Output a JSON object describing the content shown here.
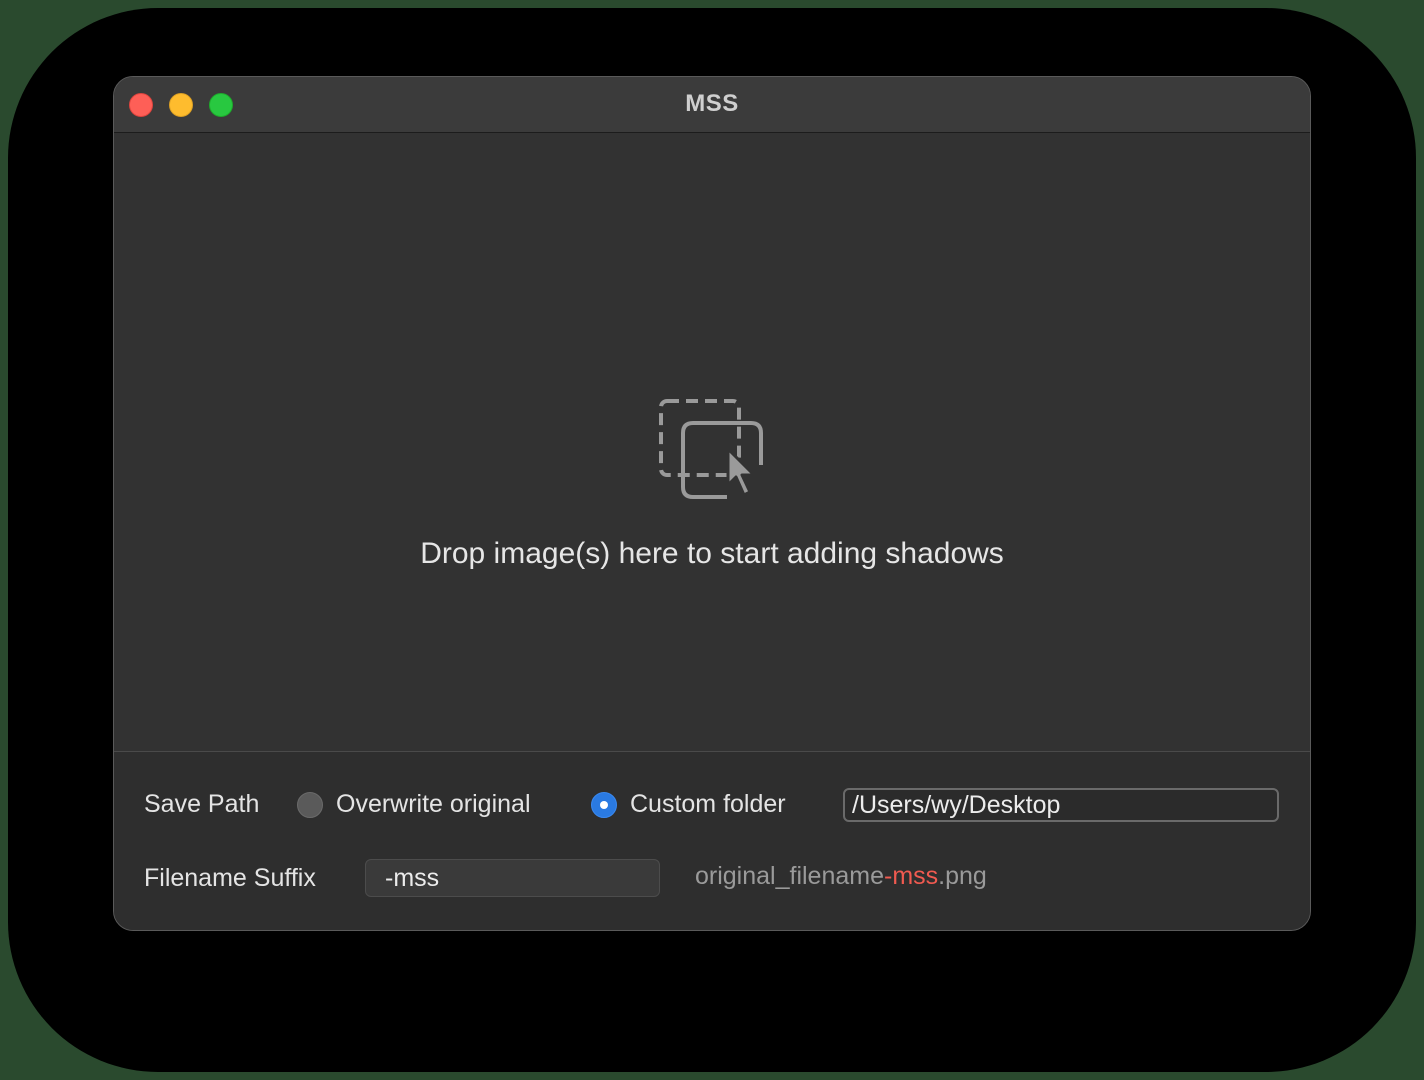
{
  "window": {
    "title": "MSS"
  },
  "dropzone": {
    "icon": "drop-images-icon",
    "text": "Drop image(s) here to start adding shadows"
  },
  "settings": {
    "save_path_label": "Save Path",
    "overwrite_label": "Overwrite original",
    "overwrite_selected": false,
    "custom_folder_label": "Custom folder",
    "custom_folder_selected": true,
    "custom_folder_path": "/Users/wy/Desktop",
    "suffix_label": "Filename Suffix",
    "suffix_value": "-mss",
    "preview": {
      "base": "original_filename",
      "suffix": "-mss",
      "extension": ".png"
    }
  },
  "colors": {
    "accent_radio": "#2a7ae2",
    "preview_suffix": "#f05a50",
    "traffic_close": "#fe5f57",
    "traffic_minimize": "#febc2e",
    "traffic_zoom": "#28c840"
  }
}
